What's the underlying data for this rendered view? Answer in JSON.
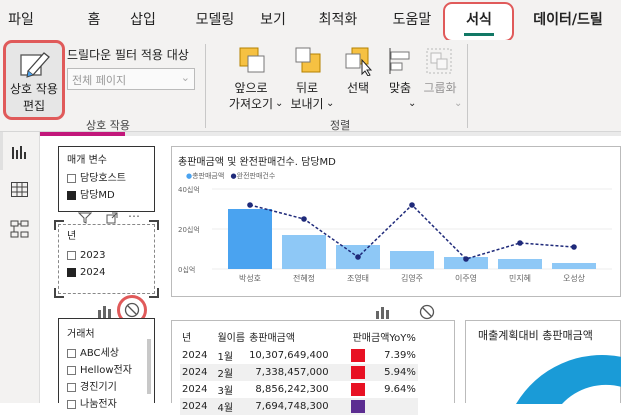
{
  "ribbon_tabs": [
    "파일",
    "홈",
    "삽입",
    "모델링",
    "보기",
    "최적화",
    "도움말",
    "서식",
    "데이터/드릴"
  ],
  "ribbon": {
    "edit_interactions_label_1": "상호 작용",
    "edit_interactions_label_2": "편집",
    "drilldown_filter_label": "드릴다운 필터 적용 대상",
    "drilldown_select_value": "전체 페이지",
    "bring_forward_1": "앞으로",
    "bring_forward_2": "가져오기",
    "send_backward_1": "뒤로",
    "send_backward_2": "보내기",
    "selection": "선택",
    "align": "맞춤",
    "group": "그룹화",
    "group_interactions": "상호 작용",
    "group_arrange": "정렬"
  },
  "slicer_measure": {
    "title": "매개 변수",
    "items": [
      {
        "label": "담당호스트",
        "checked": false
      },
      {
        "label": "담당MD",
        "checked": true
      }
    ]
  },
  "slicer_year": {
    "title": "년",
    "items": [
      {
        "label": "2023",
        "checked": false
      },
      {
        "label": "2024",
        "checked": true
      }
    ]
  },
  "slicer_vendor": {
    "title": "거래처",
    "items": [
      "ABC세상",
      "Hellow전자",
      "경진기기",
      "나눔전자"
    ]
  },
  "combo_chart": {
    "title": "총판매금액 및 완전판매건수. 담당MD",
    "legend": [
      "총판매금액",
      "완전판매건수"
    ]
  },
  "chart_data": {
    "type": "bar",
    "title": "총판매금액 및 완전판매건수. 담당MD",
    "categories": [
      "박성호",
      "전혜정",
      "조영태",
      "김영주",
      "이주영",
      "민지혜",
      "오성상"
    ],
    "y_ticks": [
      "40십억",
      "20십억",
      "0십억"
    ],
    "ylim": [
      0,
      40
    ],
    "series": [
      {
        "name": "총판매금액",
        "type": "bar",
        "values": [
          30,
          17,
          12,
          9,
          6,
          5,
          3
        ]
      },
      {
        "name": "완전판매건수",
        "type": "line",
        "values": [
          32,
          25,
          6,
          32,
          5,
          13,
          11
        ]
      }
    ],
    "colors": {
      "bar": "#8ec8f6",
      "bar_first": "#4aa3f0",
      "line": "#1f2a7a"
    }
  },
  "table": {
    "headers": [
      "년",
      "월이름",
      "총판매금액",
      "판매금액YoY%"
    ],
    "rows": [
      [
        "2024",
        "1월",
        "10,307,649,400",
        "7.39%"
      ],
      [
        "2024",
        "2월",
        "7,338,457,000",
        "5.94%"
      ],
      [
        "2024",
        "3월",
        "8,856,242,300",
        "9.64%"
      ],
      [
        "2024",
        "4월",
        "7,694,748,300",
        ""
      ]
    ]
  },
  "gauge_card": {
    "title": "매출계획대비 총판매금액"
  }
}
